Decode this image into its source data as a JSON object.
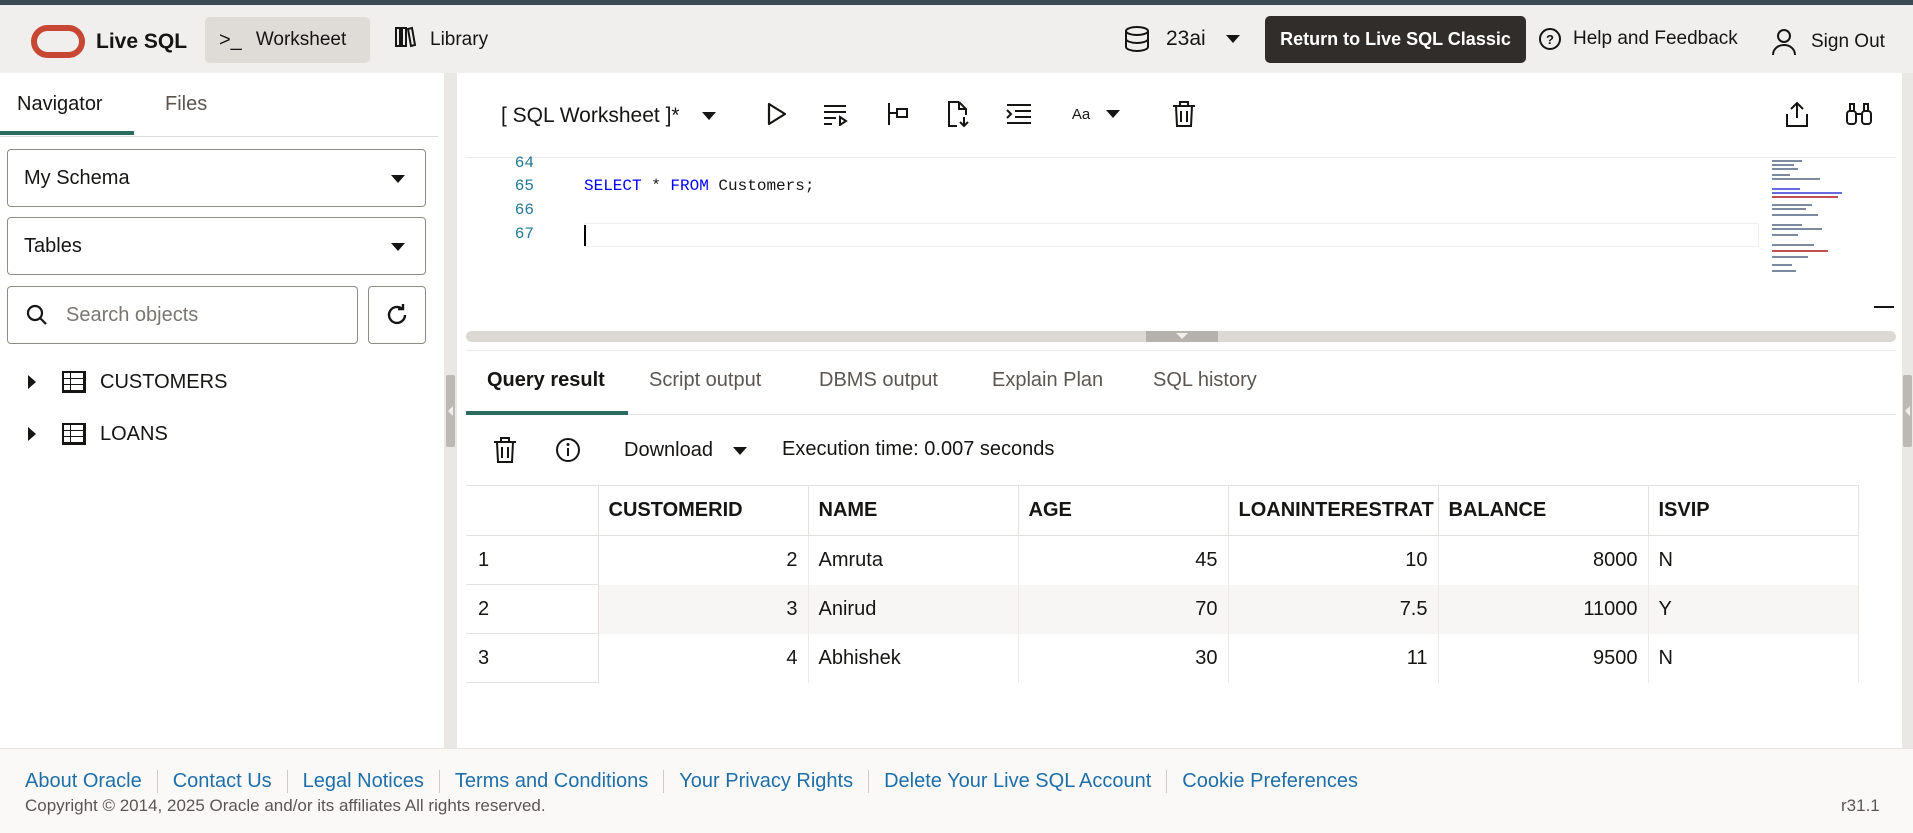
{
  "header": {
    "brand": "Live SQL",
    "nav": [
      {
        "label": "Worksheet",
        "icon": "terminal-icon",
        "active": true
      },
      {
        "label": "Library",
        "icon": "books-icon",
        "active": false
      }
    ],
    "db_version": "23ai",
    "classic_button": "Return to Live SQL Classic",
    "help": "Help and Feedback",
    "signout": "Sign Out"
  },
  "navigator": {
    "tabs": [
      "Navigator",
      "Files"
    ],
    "active_tab": "Navigator",
    "schema_select": "My Schema",
    "type_select": "Tables",
    "search_placeholder": "Search objects",
    "items": [
      "CUSTOMERS",
      "LOANS"
    ]
  },
  "worksheet": {
    "name": "[ SQL Worksheet ]*",
    "font_label": "Aa",
    "lines": [
      {
        "num": "64",
        "code": ""
      },
      {
        "num": "65",
        "code": "SELECT * FROM Customers;"
      },
      {
        "num": "66",
        "code": ""
      },
      {
        "num": "67",
        "code": ""
      }
    ],
    "code_kw1": "SELECT",
    "code_star": " * ",
    "code_kw2": "FROM",
    "code_rest": " Customers;"
  },
  "results": {
    "tabs": [
      "Query result",
      "Script output",
      "DBMS output",
      "Explain Plan",
      "SQL history"
    ],
    "active_tab": "Query result",
    "download_label": "Download",
    "execution_time": "Execution time: 0.007 seconds",
    "columns": [
      "CUSTOMERID",
      "NAME",
      "AGE",
      "LOANINTERESTRAT",
      "BALANCE",
      "ISVIP"
    ],
    "rows": [
      {
        "idx": "1",
        "CUSTOMERID": "2",
        "NAME": "Amruta",
        "AGE": "45",
        "LOANINTERESTRAT": "10",
        "BALANCE": "8000",
        "ISVIP": "N"
      },
      {
        "idx": "2",
        "CUSTOMERID": "3",
        "NAME": "Anirud",
        "AGE": "70",
        "LOANINTERESTRAT": "7.5",
        "BALANCE": "11000",
        "ISVIP": "Y"
      },
      {
        "idx": "3",
        "CUSTOMERID": "4",
        "NAME": "Abhishek",
        "AGE": "30",
        "LOANINTERESTRAT": "11",
        "BALANCE": "9500",
        "ISVIP": "N"
      }
    ]
  },
  "footer": {
    "links": [
      "About Oracle",
      "Contact Us",
      "Legal Notices",
      "Terms and Conditions",
      "Your Privacy Rights",
      "Delete Your Live SQL Account",
      "Cookie Preferences"
    ],
    "copyright": "Copyright © 2014, 2025 Oracle and/or its affiliates All rights reserved.",
    "version": "r31.1"
  },
  "colors": {
    "accent": "#2c6b5f",
    "brand_red": "#c74634",
    "dark_button": "#312d2a",
    "link": "#1e6fa8",
    "keyword": "#0000ff"
  }
}
